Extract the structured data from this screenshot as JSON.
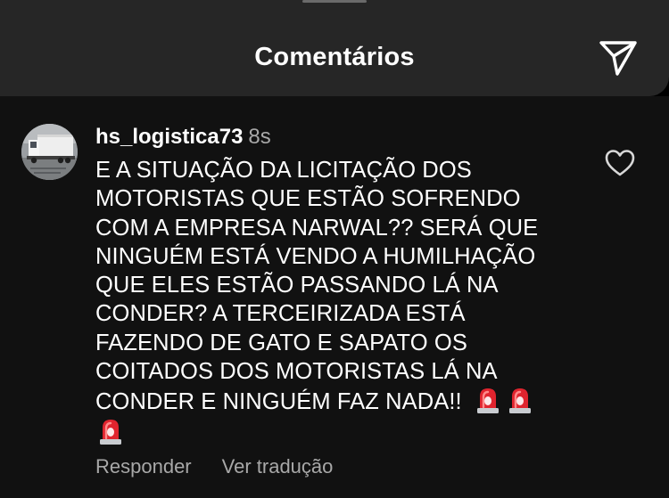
{
  "header": {
    "title": "Comentários",
    "share_icon": "paper-plane-icon"
  },
  "comment": {
    "avatar_icon": "truck-photo-avatar",
    "username": "hs_logistica73",
    "timestamp": "8s",
    "text_lines": [
      "E A SITUAÇÃO DA LICITAÇÃO DOS",
      "MOTORISTAS QUE ESTÃO SOFRENDO",
      "COM A EMPRESA NARWAL?? SERÁ QUE",
      "NINGUÉM ESTÁ VENDO A HUMILHAÇÃO",
      "QUE ELES ESTÃO PASSANDO LÁ NA",
      "CONDER? A TERCEIRIZADA ESTÁ",
      "FAZENDO DE GATO E SAPATO OS",
      "COITADOS DOS MOTORISTAS LÁ NA",
      "CONDER E NINGUÉM FAZ NADA!!"
    ],
    "emoji": [
      "police-car-light",
      "police-car-light",
      "police-car-light"
    ],
    "like_icon": "heart-outline-icon",
    "actions": {
      "reply": "Responder",
      "translate": "Ver tradução"
    }
  },
  "colors": {
    "header_bg": "#262626",
    "comment_bg": "#111111",
    "text_primary": "#ffffff",
    "text_secondary": "#a8a8a8",
    "siren_red": "#e0242e"
  }
}
